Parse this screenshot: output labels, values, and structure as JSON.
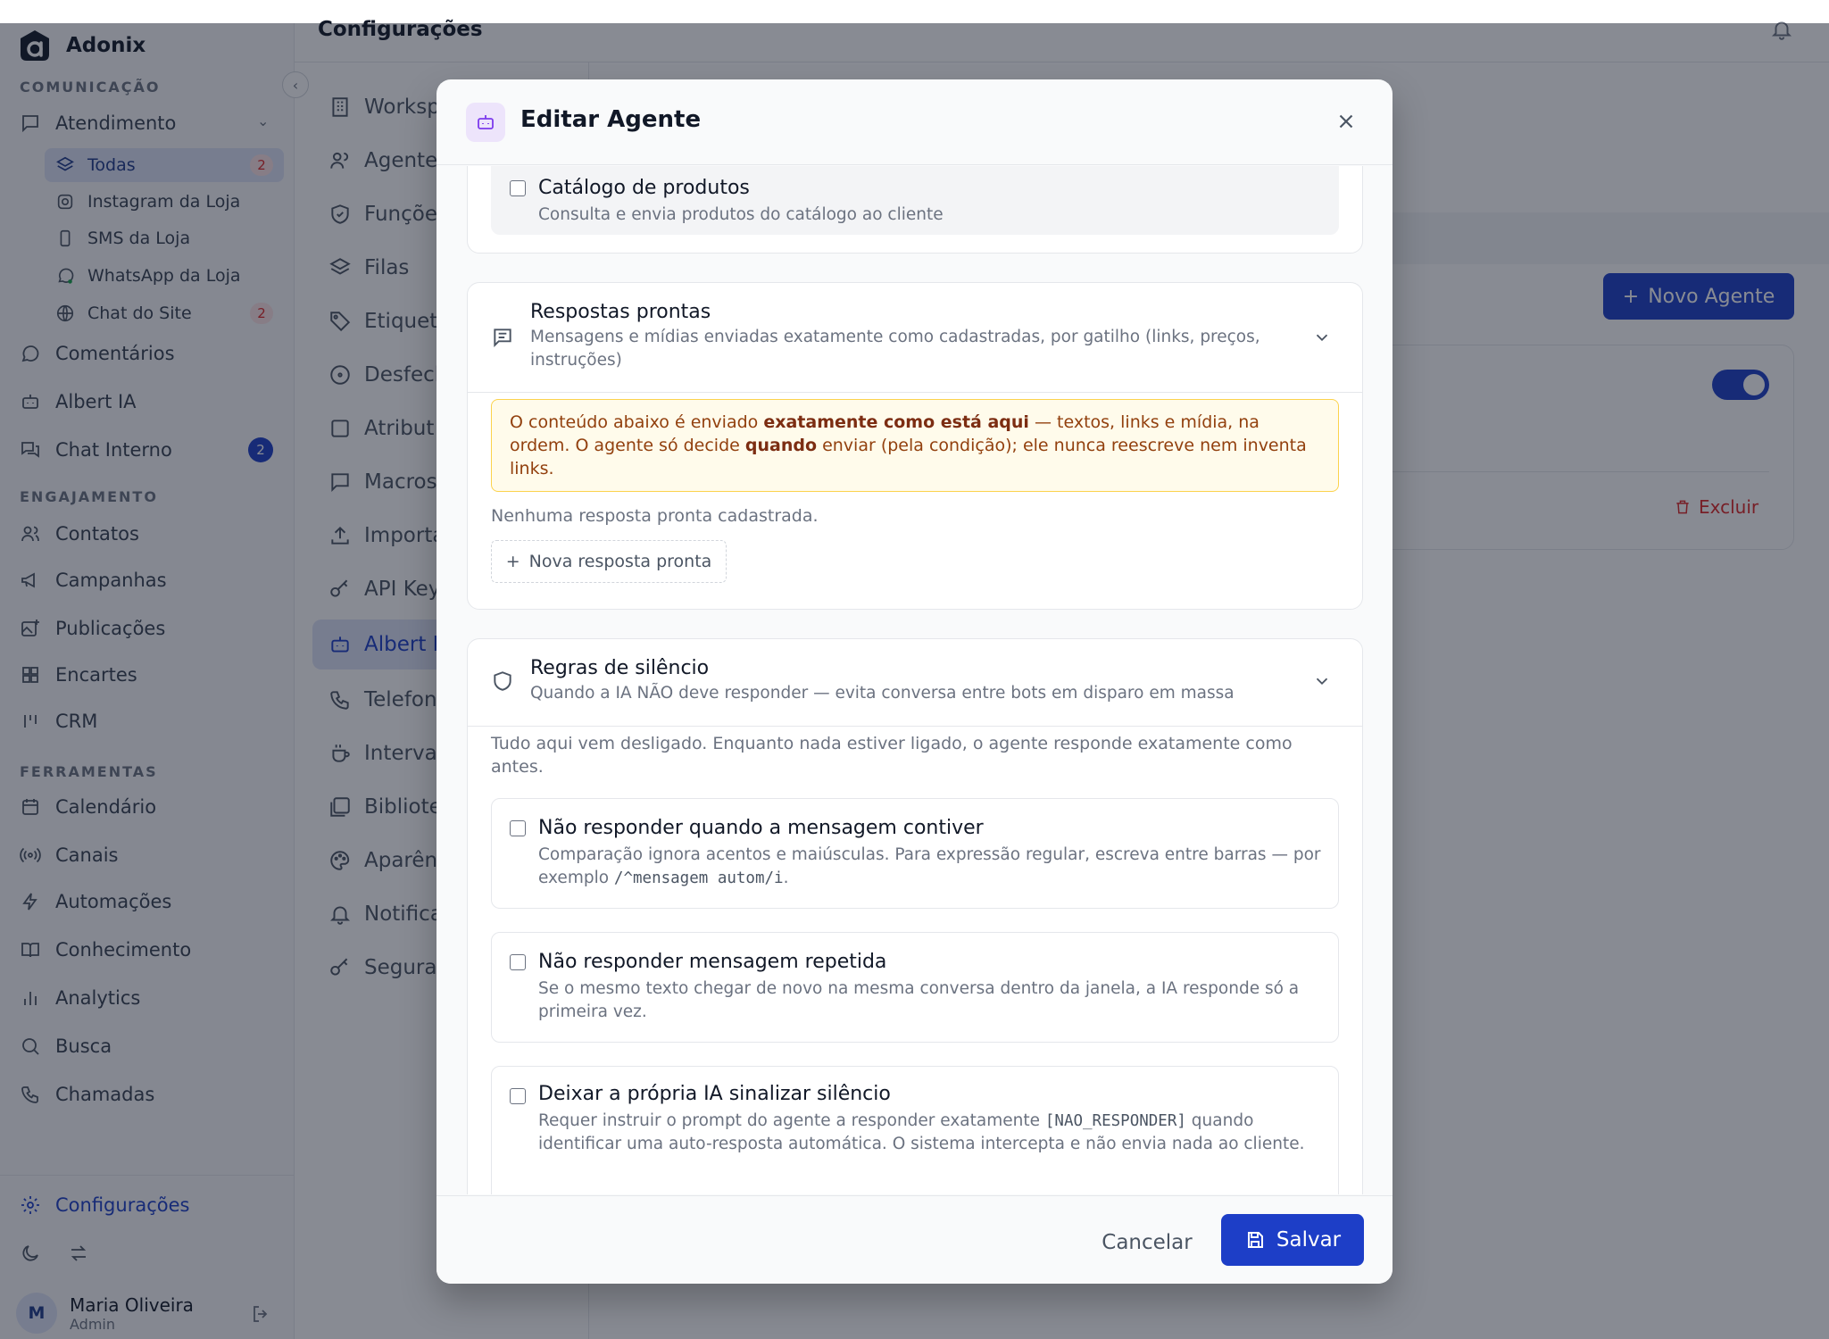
{
  "app": {
    "name": "Adonix"
  },
  "sidebar": {
    "sections": {
      "comunicacao": "COMUNICAÇÃO",
      "engajamento": "ENGAJAMENTO",
      "ferramentas": "FERRAMENTAS"
    },
    "atendimento": "Atendimento",
    "inboxes": [
      {
        "label": "Todas",
        "badge": "2"
      },
      {
        "label": "Instagram da Loja",
        "badge": ""
      },
      {
        "label": "SMS da Loja",
        "badge": ""
      },
      {
        "label": "WhatsApp da Loja",
        "badge": ""
      },
      {
        "label": "Chat do Site",
        "badge": "2"
      }
    ],
    "comunicacao_items": [
      {
        "label": "Comentários"
      },
      {
        "label": "Albert IA"
      },
      {
        "label": "Chat Interno",
        "badge": "2"
      }
    ],
    "engajamento_items": [
      {
        "label": "Contatos"
      },
      {
        "label": "Campanhas"
      },
      {
        "label": "Publicações"
      },
      {
        "label": "Encartes"
      },
      {
        "label": "CRM"
      }
    ],
    "ferramentas_items": [
      {
        "label": "Calendário"
      },
      {
        "label": "Canais"
      },
      {
        "label": "Automações"
      },
      {
        "label": "Conhecimento"
      },
      {
        "label": "Analytics"
      },
      {
        "label": "Busca"
      },
      {
        "label": "Chamadas"
      }
    ],
    "settings": "Configurações",
    "user": {
      "initial": "M",
      "name": "Maria Oliveira",
      "role": "Admin"
    }
  },
  "header": {
    "title": "Configurações"
  },
  "settings_menu": [
    {
      "label": "Worksp"
    },
    {
      "label": "Agente"
    },
    {
      "label": "Funçõe"
    },
    {
      "label": "Filas"
    },
    {
      "label": "Etiquet"
    },
    {
      "label": "Desfech"
    },
    {
      "label": "Atribut"
    },
    {
      "label": "Macros"
    },
    {
      "label": "Importa"
    },
    {
      "label": "API Key"
    },
    {
      "label": "Albert I"
    },
    {
      "label": "Telefon"
    },
    {
      "label": "Interva"
    },
    {
      "label": "Bibliote"
    },
    {
      "label": "Aparên"
    },
    {
      "label": "Notifica"
    },
    {
      "label": "Segura"
    }
  ],
  "main": {
    "new_agent": "Novo Agente",
    "delete": "Excluir"
  },
  "modal": {
    "title": "Editar Agente",
    "catalog": {
      "title": "Catálogo de produtos",
      "desc": "Consulta e envia produtos do catálogo ao cliente"
    },
    "quick_replies": {
      "title": "Respostas prontas",
      "desc": "Mensagens e mídias enviadas exatamente como cadastradas, por gatilho (links, preços, instruções)",
      "warning": {
        "p1": "O conteúdo abaixo é enviado ",
        "b1": "exatamente como está aqui",
        "p2": " — textos, links e mídia, na ordem. O agente só decide ",
        "b2": "quando",
        "p3": " enviar (pela condição); ele nunca reescreve nem inventa links."
      },
      "empty": "Nenhuma resposta pronta cadastrada.",
      "add": "Nova resposta pronta"
    },
    "silence": {
      "title": "Regras de silêncio",
      "desc": "Quando a IA NÃO deve responder — evita conversa entre bots em disparo em massa",
      "intro": "Tudo aqui vem desligado. Enquanto nada estiver ligado, o agente responde exatamente como antes.",
      "rule1": {
        "title": "Não responder quando a mensagem contiver",
        "desc": "Comparação ignora acentos e maiúsculas. Para expressão regular, escreva entre barras — por exemplo ",
        "code": "/^mensagem autom/i",
        "end": "."
      },
      "rule2": {
        "title": "Não responder mensagem repetida",
        "desc": "Se o mesmo texto chegar de novo na mesma conversa dentro da janela, a IA responde só a primeira vez."
      },
      "rule3": {
        "title": "Deixar a própria IA sinalizar silêncio",
        "desc1": "Requer instruir o prompt do agente a responder exatamente ",
        "code": "[NAO_RESPONDER]",
        "desc2": " quando identificar uma auto-resposta automática. O sistema intercepta e não envia nada ao cliente."
      }
    },
    "cancel": "Cancelar",
    "save": "Salvar"
  }
}
